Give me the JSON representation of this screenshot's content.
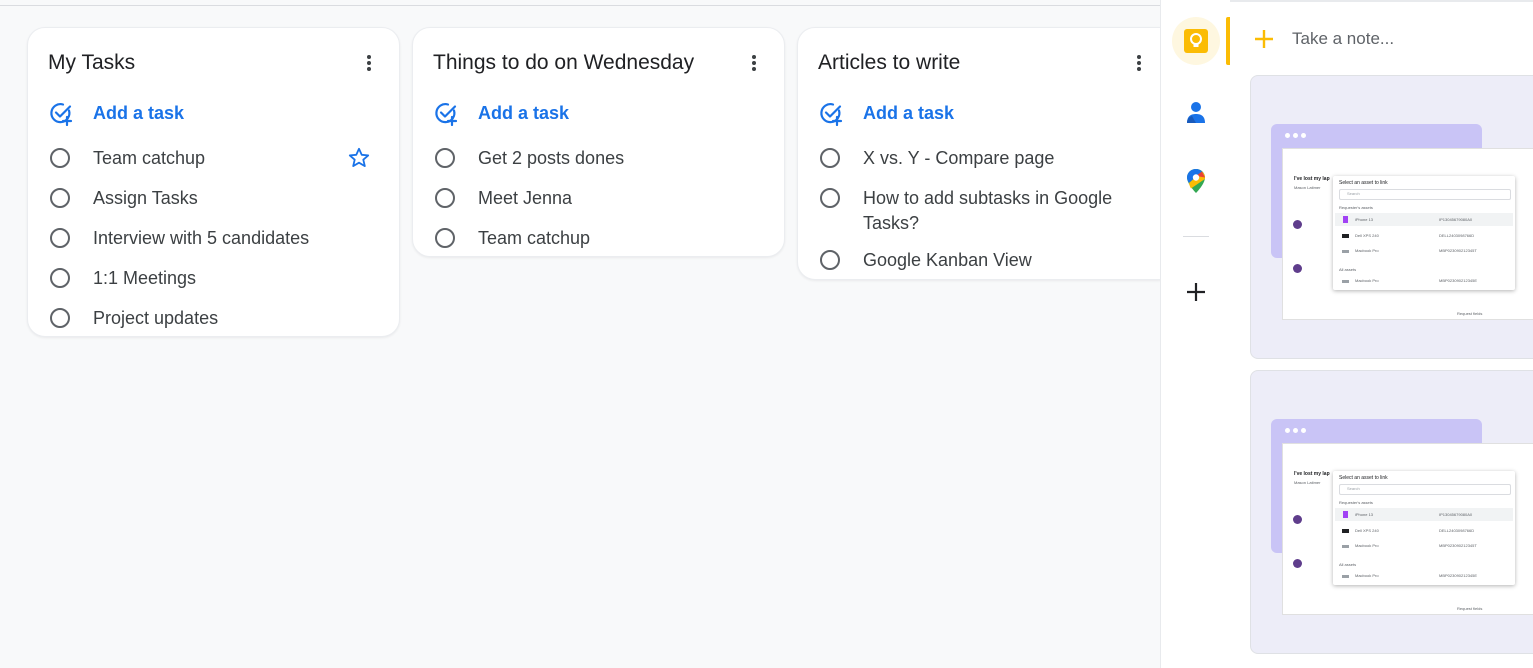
{
  "lists": [
    {
      "title": "My Tasks",
      "add_label": "Add a task",
      "tasks": [
        {
          "text": "Team catchup",
          "starred": true
        },
        {
          "text": "Assign Tasks"
        },
        {
          "text": "Interview with 5 candidates"
        },
        {
          "text": "1:1 Meetings"
        },
        {
          "text": "Project updates"
        }
      ]
    },
    {
      "title": "Things to do on Wednesday",
      "add_label": "Add a task",
      "tasks": [
        {
          "text": "Get 2 posts dones"
        },
        {
          "text": "Meet Jenna"
        },
        {
          "text": "Team catchup"
        }
      ]
    },
    {
      "title": "Articles to write",
      "add_label": "Add a task",
      "tasks": [
        {
          "text": "X vs. Y - Compare page"
        },
        {
          "text": "How to add subtasks in Google Tasks?"
        },
        {
          "text": "Google Kanban View"
        }
      ]
    }
  ],
  "side_rail": {
    "icons": [
      "keep-icon",
      "contacts-icon",
      "maps-icon",
      "add-icon"
    ],
    "active": "keep-icon"
  },
  "keep_panel": {
    "take_note_label": "Take a note...",
    "notes": [
      {
        "thumb": {
          "heading": "I've lost my lap",
          "reporter": "Mason Latimer",
          "popup_title": "Select an asset to link",
          "search_placeholder": "Search",
          "section_requesters": "Requester's assets",
          "items": [
            {
              "name": "iPhone 13",
              "serial": "IP13045679080A0"
            },
            {
              "name": "Dell XPS 240",
              "serial": "DELL2403098766D"
            },
            {
              "name": "Macbook Pro",
              "serial": "MBP023090212345T"
            }
          ],
          "section_all": "All assets",
          "all_item": {
            "name": "Macbook Pro",
            "serial": "MBP023090212345E"
          },
          "footer": "Request fields"
        }
      },
      {
        "thumb": {
          "heading": "I've lost my lap",
          "reporter": "Mason Latimer",
          "popup_title": "Select an asset to link",
          "search_placeholder": "Search",
          "section_requesters": "Requester's assets",
          "items": [
            {
              "name": "iPhone 13",
              "serial": "IP13045679080A0"
            },
            {
              "name": "Dell XPS 240",
              "serial": "DELL2403098766D"
            },
            {
              "name": "Macbook Pro",
              "serial": "MBP023090212345T"
            }
          ],
          "section_all": "All assets",
          "all_item": {
            "name": "Macbook Pro",
            "serial": "MBP023090212345E"
          },
          "footer": "Request fields"
        }
      }
    ]
  },
  "colors": {
    "accent_blue": "#1a73e8",
    "keep_yellow": "#fbbc04",
    "note_purple": "#c9c4f6"
  }
}
